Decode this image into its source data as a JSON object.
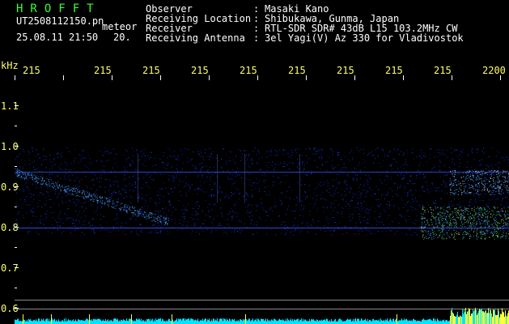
{
  "header": {
    "title": "HROFFT",
    "filename": "UT2508112150.pn",
    "tag": "meteor",
    "datetime": "25.08.11 21:50",
    "extra": "20.",
    "fields": [
      {
        "label": "Observer",
        "value": "Masaki Kano"
      },
      {
        "label": "Receiving Location",
        "value": "Shibukawa, Gunma, Japan"
      },
      {
        "label": "Receiver",
        "value": "RTL-SDR SDR# 43dB L15 103.2MHz CW"
      },
      {
        "label": "Receiving Antenna",
        "value": "3el Yagi(V) Az 330 for Vladivostok"
      }
    ]
  },
  "axis": {
    "y_unit": "kHz",
    "y_ticks": [
      "1.1",
      "1.0",
      "0.9",
      "0.8",
      "0.7",
      "0.6"
    ],
    "x_ticks": [
      "215",
      "215",
      "215",
      "215",
      "215",
      "215",
      "215",
      "215",
      "215",
      "2200"
    ]
  },
  "colors": {
    "background": "#000000",
    "text": "#ffffff",
    "tick_text": "#ffff66",
    "title": "#33ff33",
    "noise": "#1a3cff",
    "signal": "#4aa0ff",
    "hot": "#ffd84a",
    "bar": "#00e5ff"
  }
}
